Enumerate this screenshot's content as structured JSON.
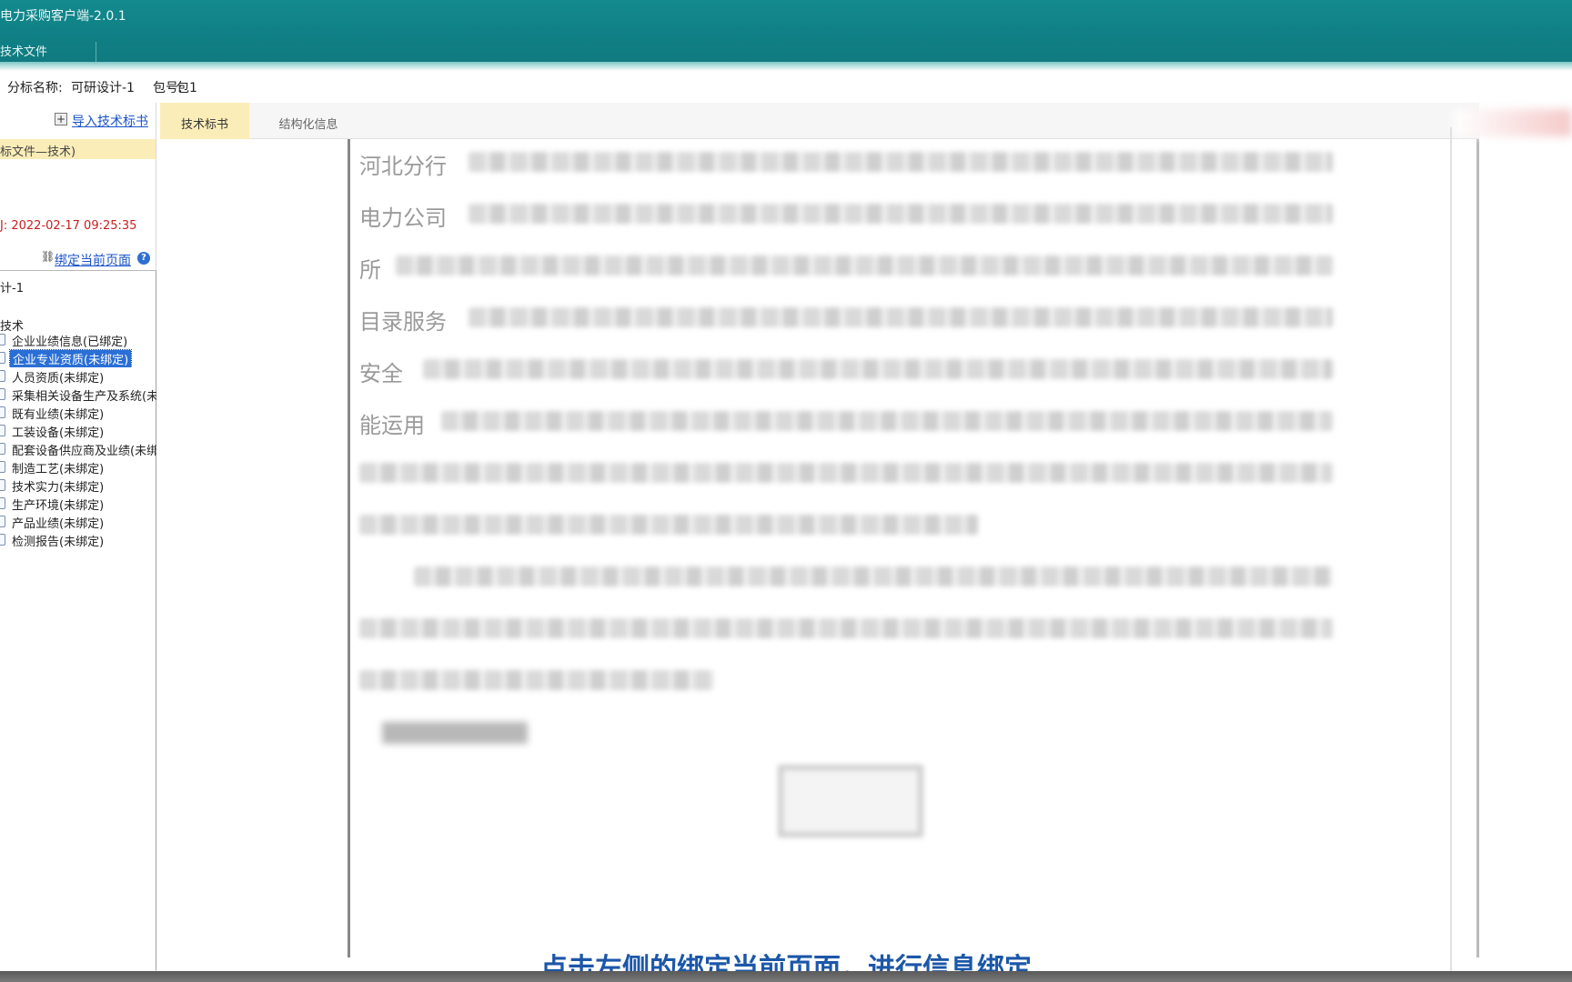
{
  "window": {
    "title": "电力采购客户端-2.0.1"
  },
  "menu": {
    "item": "技术文件"
  },
  "info": {
    "label_package": "分标名称:",
    "package_name": "可研设计-1",
    "label_bag": "包号:",
    "bag_no": "包1"
  },
  "left": {
    "import_label": "导入技术标书",
    "doc_label": "标文件—技术)",
    "time_prefix": "J:",
    "time_value": "2022-02-17 09:25:35",
    "bind_label": "绑定当前页面",
    "tree": {
      "root": "计-1",
      "parent": "技术",
      "items": [
        {
          "label": "企业业绩信息(已绑定)"
        },
        {
          "label": "企业专业资质(未绑定)"
        },
        {
          "label": "人员资质(未绑定)"
        },
        {
          "label": "采集相关设备生产及系统(未绑定)"
        },
        {
          "label": "既有业绩(未绑定)"
        },
        {
          "label": "工装设备(未绑定)"
        },
        {
          "label": "配套设备供应商及业绩(未绑定)"
        },
        {
          "label": "制造工艺(未绑定)"
        },
        {
          "label": "技术实力(未绑定)"
        },
        {
          "label": "生产环境(未绑定)"
        },
        {
          "label": "产品业绩(未绑定)"
        },
        {
          "label": "检测报告(未绑定)"
        }
      ]
    }
  },
  "tabs": {
    "tab1": "技术标书",
    "tab2": "结构化信息"
  },
  "document": {
    "line1_start": "河北分行",
    "line2_start": "电力公司",
    "line3_start": "所",
    "line4_start": "目录服务",
    "line5_start": "安全",
    "line6_start": "能运用"
  },
  "subtitle": "点击左侧的绑定当前页面，进行信息绑定"
}
